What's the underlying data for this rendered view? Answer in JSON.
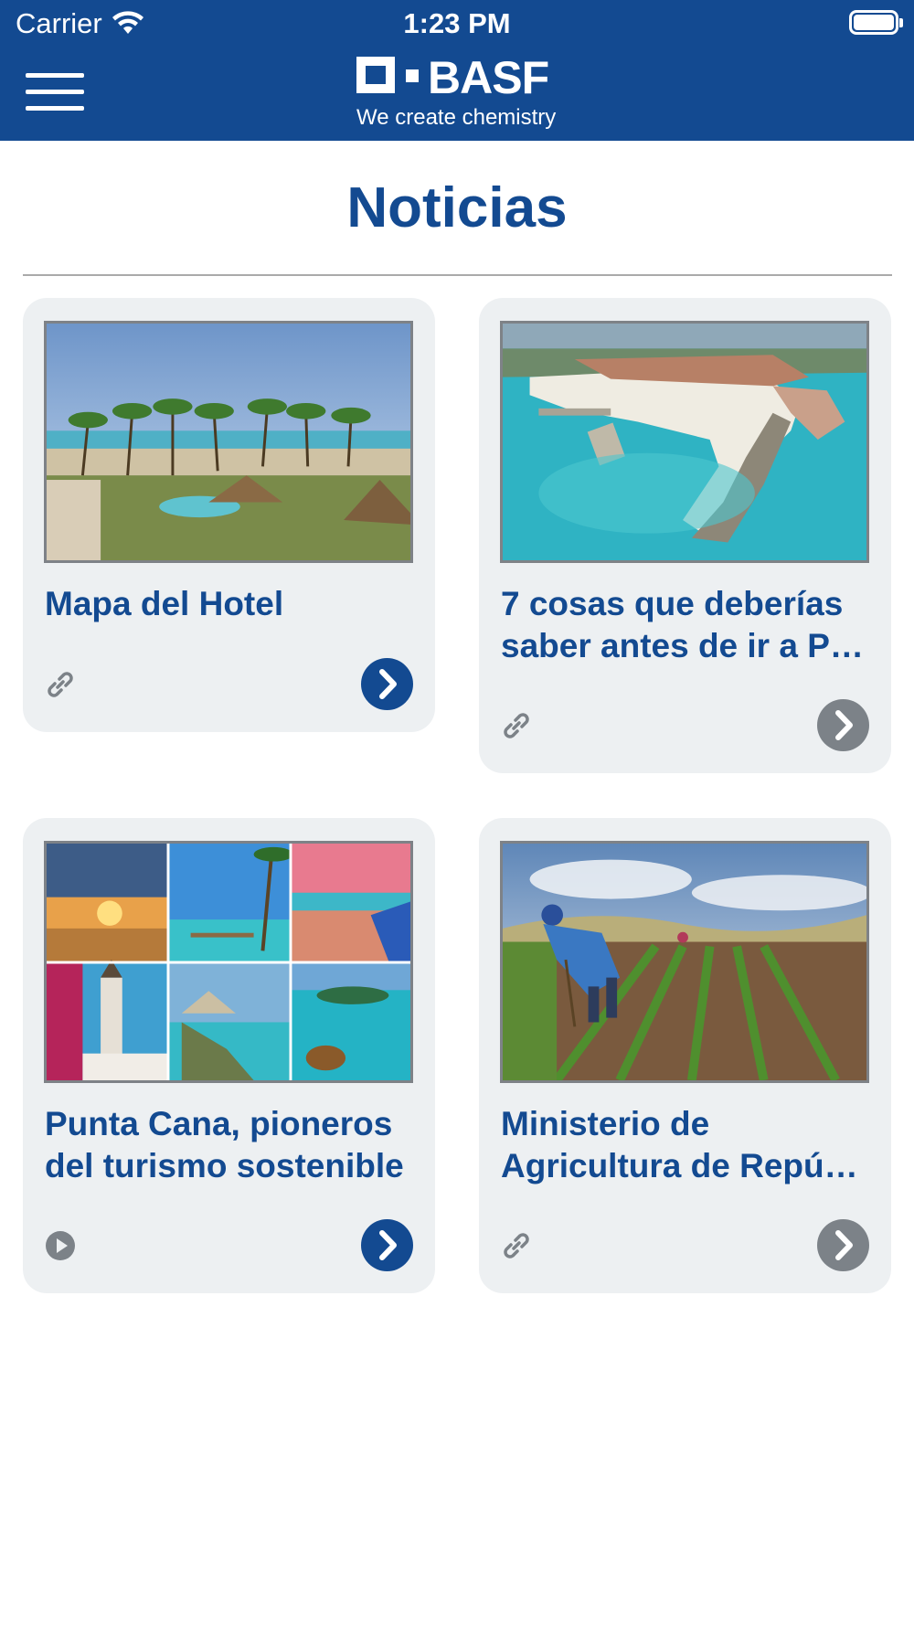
{
  "status_bar": {
    "carrier": "Carrier",
    "time": "1:23 PM"
  },
  "header": {
    "brand": "BASF",
    "tagline": "We create chemistry",
    "menu_icon": "hamburger-menu-icon",
    "color": "#134a91"
  },
  "page": {
    "title": "Noticias"
  },
  "cards": [
    {
      "title_lines": [
        "Mapa del Hotel"
      ],
      "type_icon": "link-icon",
      "button_state": "active",
      "image_description": "resort-beach-palms"
    },
    {
      "title_lines": [
        "7 cosas que deberías",
        "saber antes de ir a P…"
      ],
      "type_icon": "link-icon",
      "button_state": "inactive",
      "image_description": "aerial-marina-beach"
    },
    {
      "title_lines": [
        "Punta Cana, pioneros",
        "del turismo sostenible"
      ],
      "type_icon": "play-icon",
      "button_state": "active",
      "image_description": "caribbean-collage"
    },
    {
      "title_lines": [
        "Ministerio de",
        "Agricultura de Repúb…"
      ],
      "type_icon": "link-icon",
      "button_state": "inactive",
      "image_description": "farmer-crop-field"
    }
  ],
  "colors": {
    "brand_blue": "#134a91",
    "card_bg": "#edf0f2",
    "inactive_gray": "#7c8288"
  }
}
